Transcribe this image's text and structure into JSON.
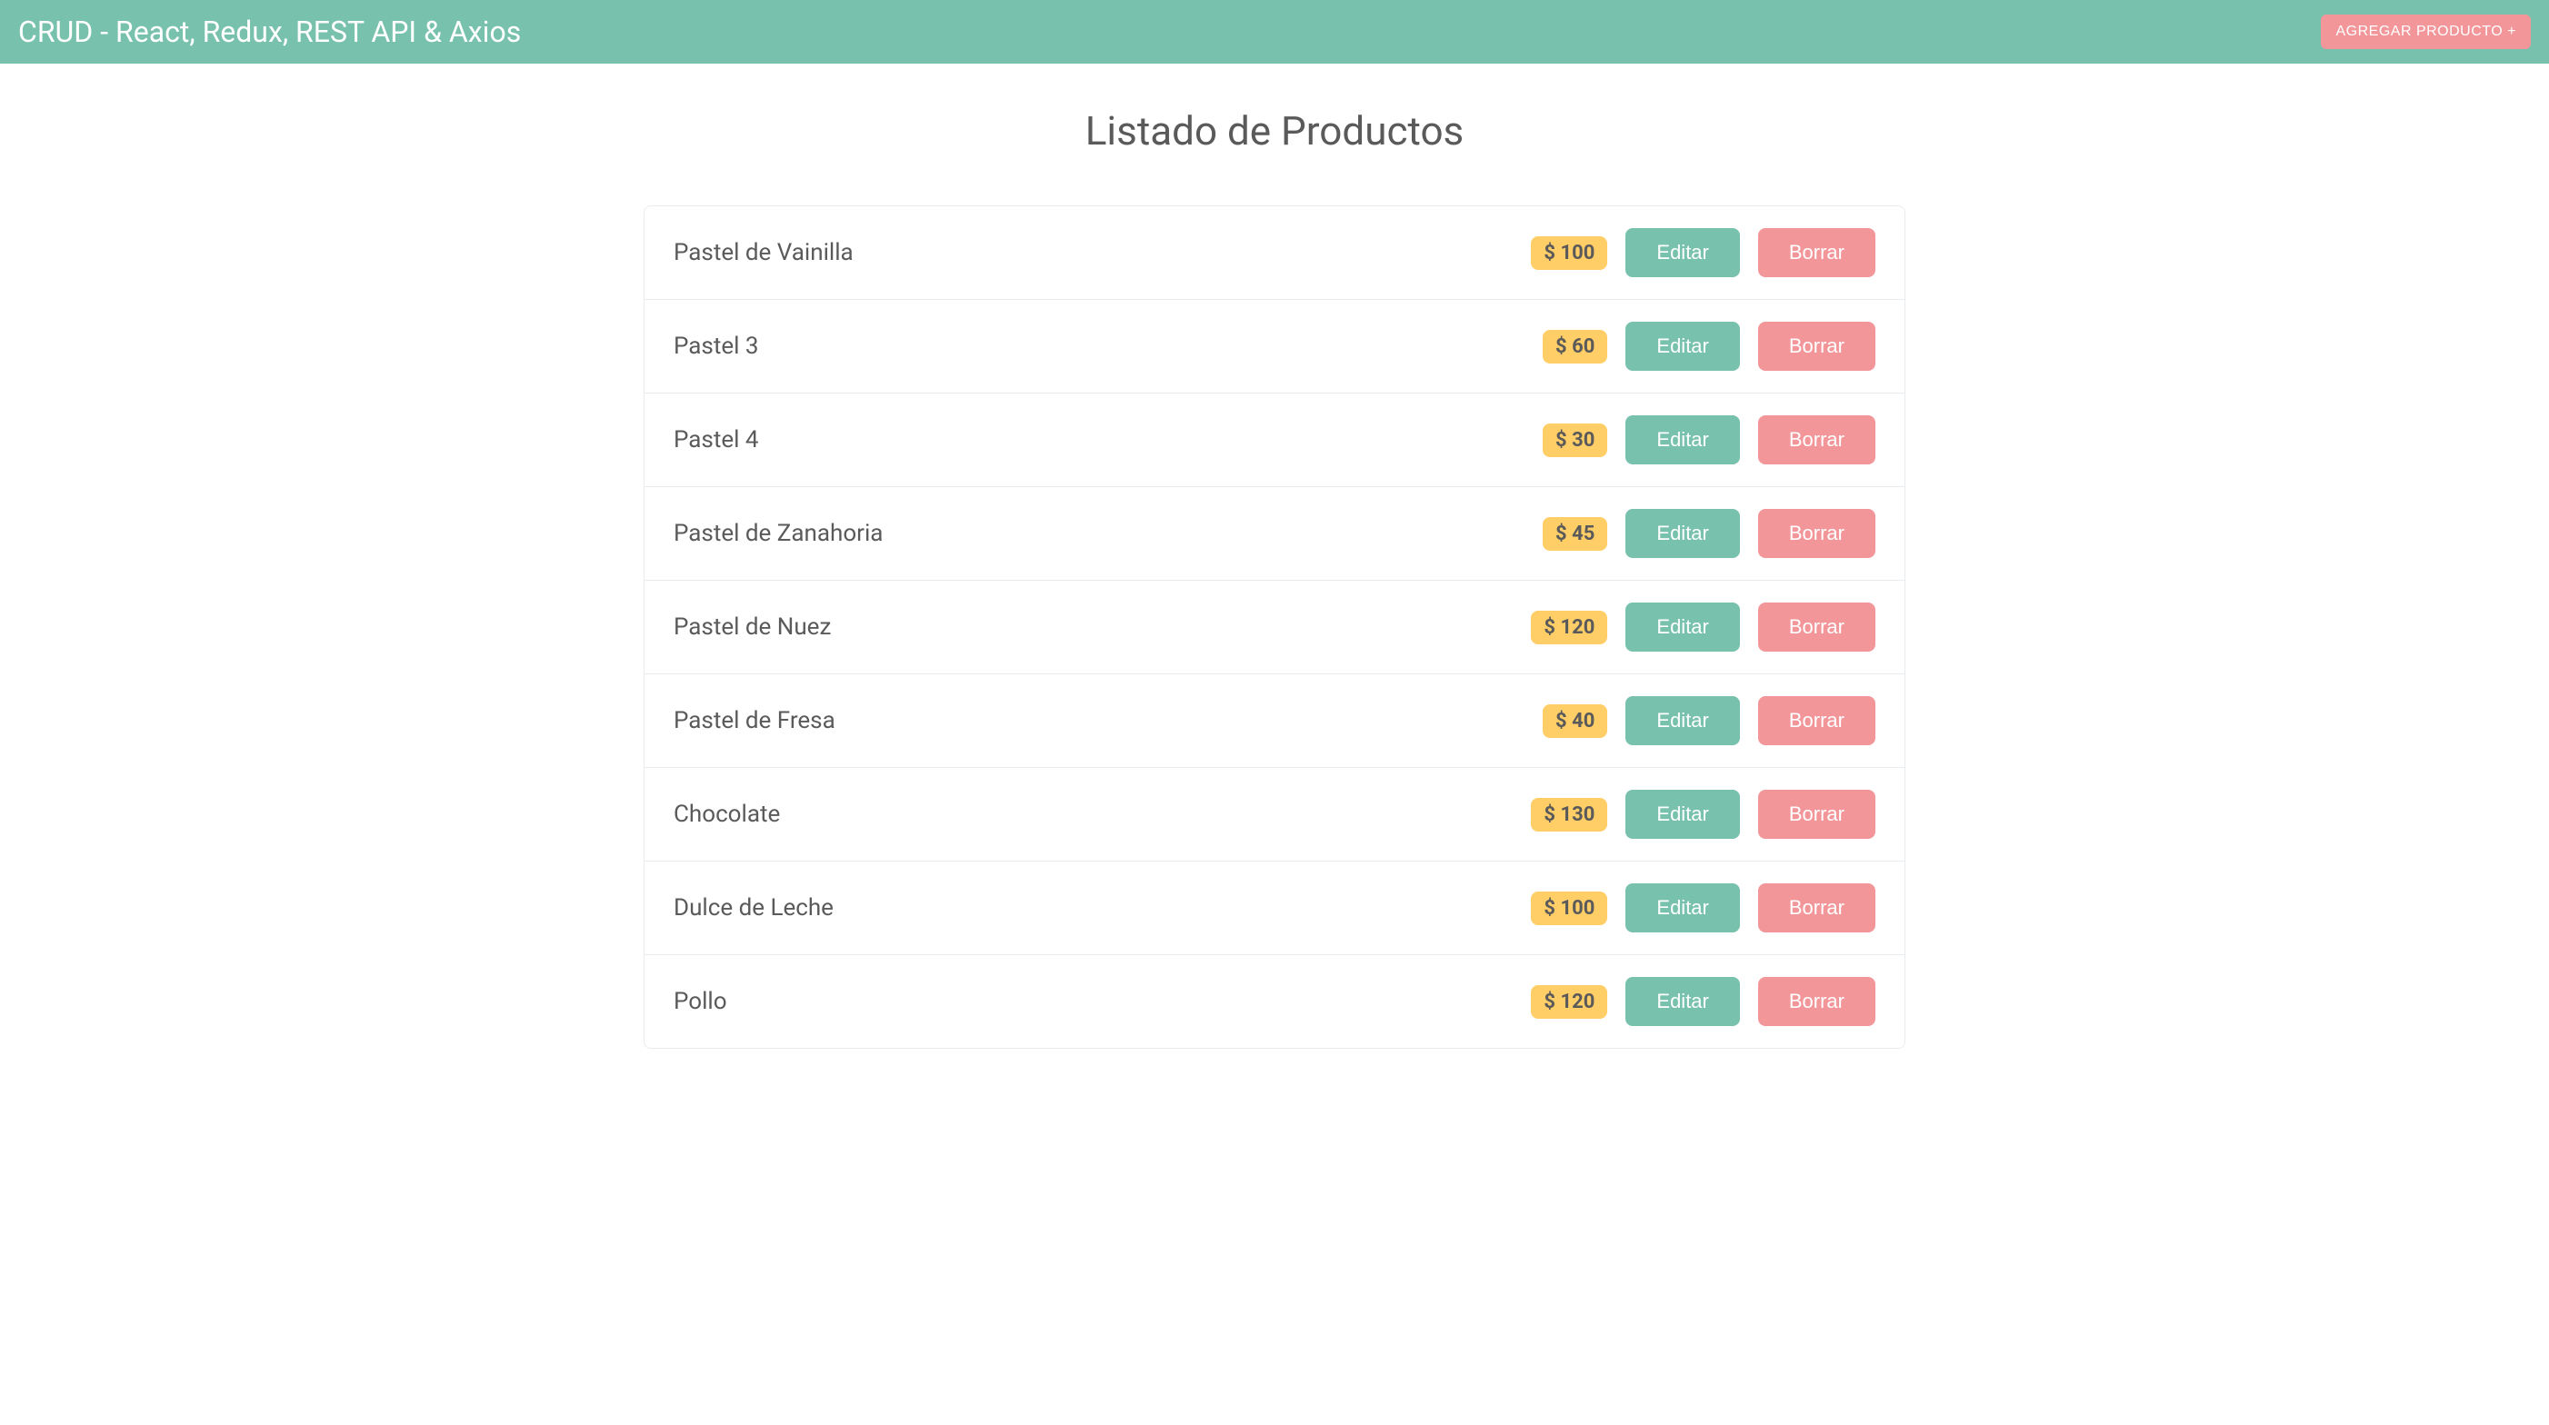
{
  "navbar": {
    "brand": "CRUD - React, Redux, REST API & Axios",
    "addButton": "AGREGAR PRODUCTO +"
  },
  "page": {
    "title": "Listado de Productos"
  },
  "labels": {
    "edit": "Editar",
    "delete": "Borrar",
    "currency": "$"
  },
  "products": [
    {
      "name": "Pastel de Vainilla",
      "price": 100
    },
    {
      "name": "Pastel 3",
      "price": 60
    },
    {
      "name": "Pastel 4",
      "price": 30
    },
    {
      "name": "Pastel de Zanahoria",
      "price": 45
    },
    {
      "name": "Pastel de Nuez",
      "price": 120
    },
    {
      "name": "Pastel de Fresa",
      "price": 40
    },
    {
      "name": "Chocolate",
      "price": 130
    },
    {
      "name": "Dulce de Leche",
      "price": 100
    },
    {
      "name": "Pollo",
      "price": 120
    }
  ]
}
